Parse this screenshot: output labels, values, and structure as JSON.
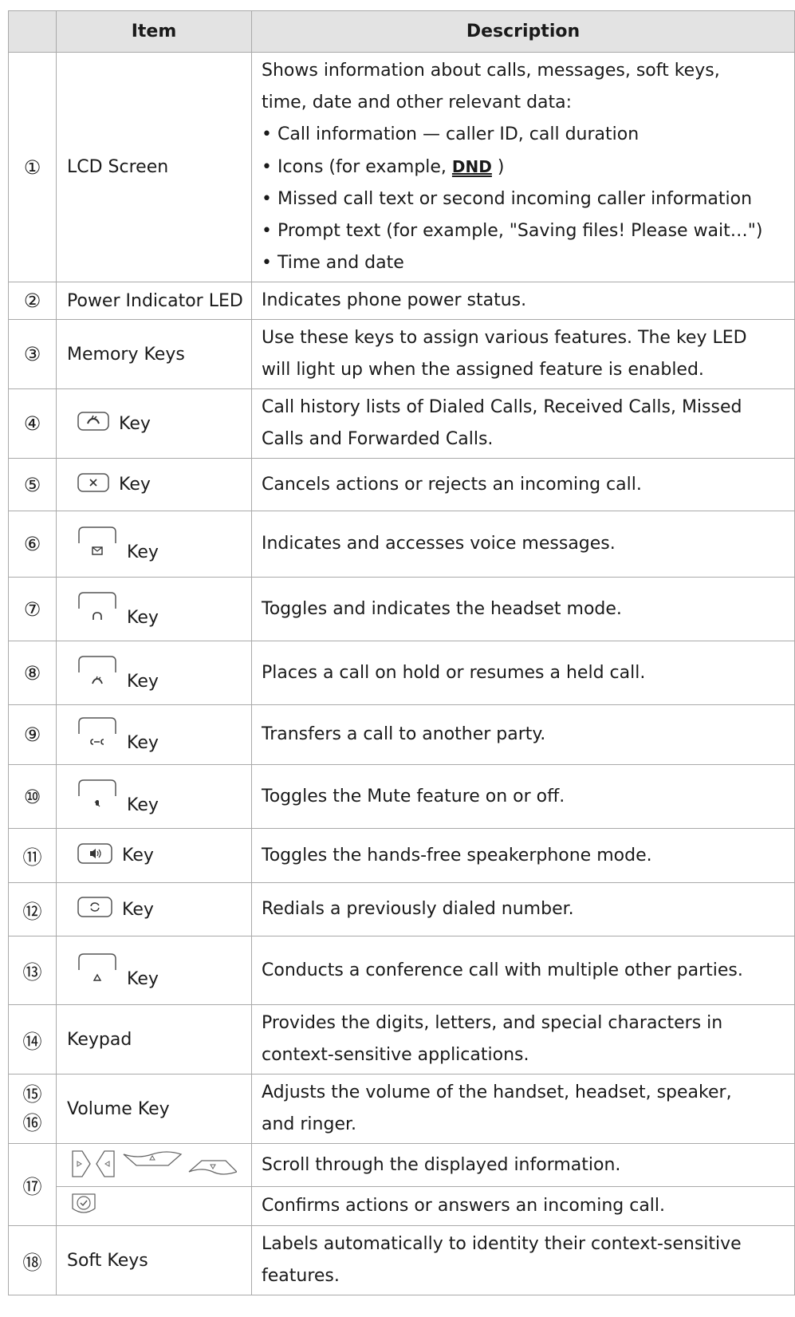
{
  "header": {
    "col_item": "Item",
    "col_desc": "Description"
  },
  "rows": [
    {
      "num": "①",
      "item": "LCD Screen",
      "desc": [
        "Shows information about calls, messages, soft keys,",
        "time, date and other relevant data:",
        "• Call information — caller ID, call duration",
        "• Missed call text or second incoming caller information",
        "• Prompt text (for example, \"Saving files! Please wait…\")",
        "• Time and date"
      ],
      "icons_line_prefix": "• Icons (for example, ",
      "icons_line_icon": "DND",
      "icons_line_suffix": " )"
    },
    {
      "num": "②",
      "item": "Power Indicator LED",
      "desc": [
        "Indicates phone power status."
      ]
    },
    {
      "num": "③",
      "item": "Memory Keys",
      "desc": [
        "Use these keys to assign various features. The key LED",
        "will light up when the assigned feature is enabled."
      ]
    },
    {
      "num": "④",
      "item": "Key",
      "icon": "call-history-key-icon",
      "desc": [
        "Call history lists of Dialed Calls, Received Calls, Missed",
        "Calls and Forwarded Calls."
      ]
    },
    {
      "num": "⑤",
      "item": "Key",
      "icon": "cancel-key-icon",
      "desc": [
        "Cancels actions or rejects an incoming call."
      ]
    },
    {
      "num": "⑥",
      "item": "Key",
      "icon": "message-key-icon",
      "desc": [
        "Indicates and accesses voice messages."
      ]
    },
    {
      "num": "⑦",
      "item": "Key",
      "icon": "headset-key-icon",
      "desc": [
        "Toggles and indicates the headset mode."
      ]
    },
    {
      "num": "⑧",
      "item": "Key",
      "icon": "hold-key-icon",
      "desc": [
        "Places a call on hold or resumes a held call."
      ]
    },
    {
      "num": "⑨",
      "item": "Key",
      "icon": "transfer-key-icon",
      "desc": [
        "Transfers a call to another party."
      ]
    },
    {
      "num": "⑩",
      "item": "Key",
      "icon": "mute-key-icon",
      "desc": [
        "Toggles the Mute feature on or off."
      ]
    },
    {
      "num": "⑪",
      "item": "Key",
      "icon": "speakerphone-key-icon",
      "desc": [
        "Toggles the hands-free speakerphone mode."
      ]
    },
    {
      "num": "⑫",
      "item": "Key",
      "icon": "redial-key-icon",
      "desc": [
        "Redials a previously dialed number."
      ]
    },
    {
      "num": "⑬",
      "item": "Key",
      "icon": "conference-key-icon",
      "desc": [
        "Conducts a conference call with multiple other parties."
      ]
    },
    {
      "num": "⑭",
      "item": "Keypad",
      "desc": [
        "Provides the digits, letters, and special characters in",
        "context-sensitive applications."
      ]
    },
    {
      "num": "⑮",
      "num2": "⑯",
      "item": "Volume Key",
      "desc": [
        "Adjusts the volume of the handset, headset, speaker,",
        "and ringer."
      ]
    },
    {
      "num": "⑰",
      "nav_desc": "Scroll through the displayed information.",
      "ok_desc": "Confirms actions or answers an incoming call."
    },
    {
      "num": "⑱",
      "item": "Soft Keys",
      "desc": [
        "Labels automatically to identity their context-sensitive",
        "features."
      ]
    }
  ],
  "colors": {
    "header_bg": "#e3e3e3",
    "border": "#a9a9a9",
    "text": "#1a1a1a"
  }
}
